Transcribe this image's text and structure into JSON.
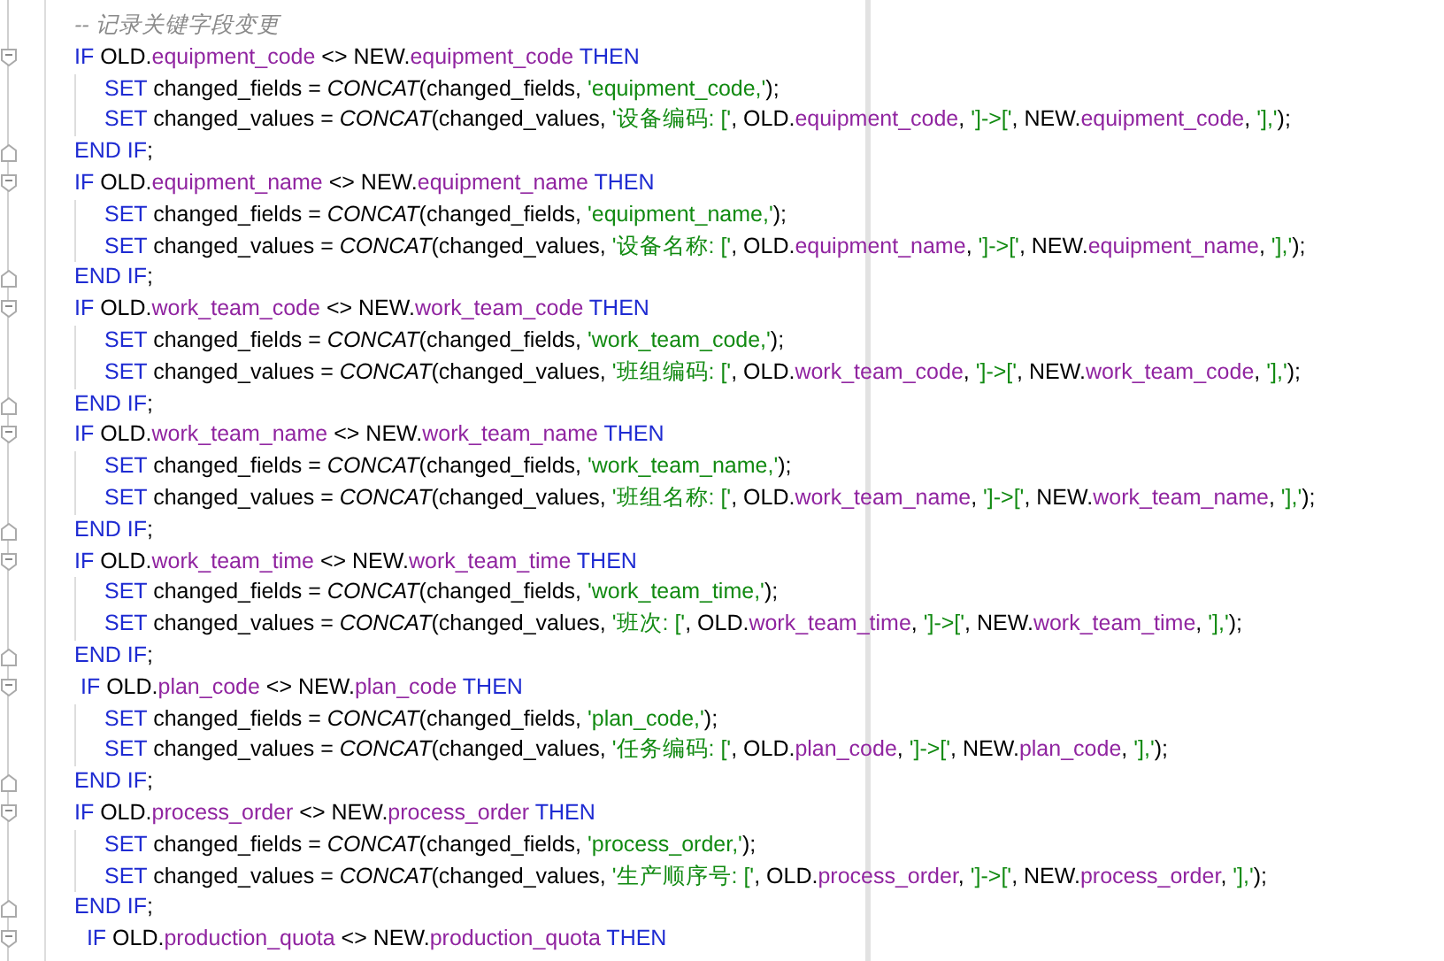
{
  "editor": {
    "lines": [
      {
        "kind": "comment",
        "tokens": [
          {
            "kind": "comment",
            "text": "-- 记录关键字段变更"
          }
        ]
      },
      {
        "kind": "block",
        "tokens": [
          {
            "kind": "kw",
            "text": "IF"
          },
          {
            "kind": "plain",
            "text": " OLD."
          },
          {
            "kind": "field",
            "text": "equipment_code"
          },
          {
            "kind": "plain",
            "text": " <> NEW."
          },
          {
            "kind": "field",
            "text": "equipment_code"
          },
          {
            "kind": "kw",
            "text": " THEN"
          }
        ],
        "children": [
          {
            "tokens": [
              {
                "kind": "kw",
                "text": "SET"
              },
              {
                "kind": "plain",
                "text": " changed_fields = "
              },
              {
                "kind": "fn",
                "text": "CONCAT"
              },
              {
                "kind": "plain",
                "text": "(changed_fields, "
              },
              {
                "kind": "str",
                "text": "'equipment_code,'"
              },
              {
                "kind": "plain",
                "text": ");"
              }
            ]
          },
          {
            "tokens": [
              {
                "kind": "kw",
                "text": "SET"
              },
              {
                "kind": "plain",
                "text": " changed_values = "
              },
              {
                "kind": "fn",
                "text": "CONCAT"
              },
              {
                "kind": "plain",
                "text": "(changed_values, "
              },
              {
                "kind": "str",
                "text": "'设备编码: ['"
              },
              {
                "kind": "plain",
                "text": ", OLD."
              },
              {
                "kind": "field",
                "text": "equipment_code"
              },
              {
                "kind": "plain",
                "text": ", "
              },
              {
                "kind": "str",
                "text": "']->['"
              },
              {
                "kind": "plain",
                "text": ", NEW."
              },
              {
                "kind": "field",
                "text": "equipment_code"
              },
              {
                "kind": "plain",
                "text": ", "
              },
              {
                "kind": "str",
                "text": "'],'"
              },
              {
                "kind": "plain",
                "text": ");"
              }
            ]
          }
        ]
      },
      {
        "kind": "end",
        "tokens": [
          {
            "kind": "kw",
            "text": "END IF"
          },
          {
            "kind": "plain",
            "text": ";"
          }
        ]
      },
      {
        "kind": "block",
        "tokens": [
          {
            "kind": "kw",
            "text": "IF"
          },
          {
            "kind": "plain",
            "text": " OLD."
          },
          {
            "kind": "field",
            "text": "equipment_name"
          },
          {
            "kind": "plain",
            "text": " <> NEW."
          },
          {
            "kind": "field",
            "text": "equipment_name"
          },
          {
            "kind": "kw",
            "text": " THEN"
          }
        ],
        "children": [
          {
            "tokens": [
              {
                "kind": "kw",
                "text": "SET"
              },
              {
                "kind": "plain",
                "text": " changed_fields = "
              },
              {
                "kind": "fn",
                "text": "CONCAT"
              },
              {
                "kind": "plain",
                "text": "(changed_fields, "
              },
              {
                "kind": "str",
                "text": "'equipment_name,'"
              },
              {
                "kind": "plain",
                "text": ");"
              }
            ]
          },
          {
            "tokens": [
              {
                "kind": "kw",
                "text": "SET"
              },
              {
                "kind": "plain",
                "text": " changed_values = "
              },
              {
                "kind": "fn",
                "text": "CONCAT"
              },
              {
                "kind": "plain",
                "text": "(changed_values, "
              },
              {
                "kind": "str",
                "text": "'设备名称: ['"
              },
              {
                "kind": "plain",
                "text": ", OLD."
              },
              {
                "kind": "field",
                "text": "equipment_name"
              },
              {
                "kind": "plain",
                "text": ", "
              },
              {
                "kind": "str",
                "text": "']->['"
              },
              {
                "kind": "plain",
                "text": ", NEW."
              },
              {
                "kind": "field",
                "text": "equipment_name"
              },
              {
                "kind": "plain",
                "text": ", "
              },
              {
                "kind": "str",
                "text": "'],'"
              },
              {
                "kind": "plain",
                "text": ");"
              }
            ]
          }
        ]
      },
      {
        "kind": "end",
        "tokens": [
          {
            "kind": "kw",
            "text": "END IF"
          },
          {
            "kind": "plain",
            "text": ";"
          }
        ]
      },
      {
        "kind": "block",
        "tokens": [
          {
            "kind": "kw",
            "text": "IF"
          },
          {
            "kind": "plain",
            "text": " OLD."
          },
          {
            "kind": "field",
            "text": "work_team_code"
          },
          {
            "kind": "plain",
            "text": " <> NEW."
          },
          {
            "kind": "field",
            "text": "work_team_code"
          },
          {
            "kind": "kw",
            "text": " THEN"
          }
        ],
        "children": [
          {
            "tokens": [
              {
                "kind": "kw",
                "text": "SET"
              },
              {
                "kind": "plain",
                "text": " changed_fields = "
              },
              {
                "kind": "fn",
                "text": "CONCAT"
              },
              {
                "kind": "plain",
                "text": "(changed_fields, "
              },
              {
                "kind": "str",
                "text": "'work_team_code,'"
              },
              {
                "kind": "plain",
                "text": ");"
              }
            ]
          },
          {
            "tokens": [
              {
                "kind": "kw",
                "text": "SET"
              },
              {
                "kind": "plain",
                "text": " changed_values = "
              },
              {
                "kind": "fn",
                "text": "CONCAT"
              },
              {
                "kind": "plain",
                "text": "(changed_values, "
              },
              {
                "kind": "str",
                "text": "'班组编码: ['"
              },
              {
                "kind": "plain",
                "text": ", OLD."
              },
              {
                "kind": "field",
                "text": "work_team_code"
              },
              {
                "kind": "plain",
                "text": ", "
              },
              {
                "kind": "str",
                "text": "']->['"
              },
              {
                "kind": "plain",
                "text": ", NEW."
              },
              {
                "kind": "field",
                "text": "work_team_code"
              },
              {
                "kind": "plain",
                "text": ", "
              },
              {
                "kind": "str",
                "text": "'],'"
              },
              {
                "kind": "plain",
                "text": ");"
              }
            ]
          }
        ]
      },
      {
        "kind": "end",
        "tokens": [
          {
            "kind": "kw",
            "text": "END IF"
          },
          {
            "kind": "plain",
            "text": ";"
          }
        ]
      },
      {
        "kind": "block",
        "tokens": [
          {
            "kind": "kw",
            "text": "IF"
          },
          {
            "kind": "plain",
            "text": " OLD."
          },
          {
            "kind": "field",
            "text": "work_team_name"
          },
          {
            "kind": "plain",
            "text": " <> NEW."
          },
          {
            "kind": "field",
            "text": "work_team_name"
          },
          {
            "kind": "kw",
            "text": " THEN"
          }
        ],
        "children": [
          {
            "tokens": [
              {
                "kind": "kw",
                "text": "SET"
              },
              {
                "kind": "plain",
                "text": " changed_fields = "
              },
              {
                "kind": "fn",
                "text": "CONCAT"
              },
              {
                "kind": "plain",
                "text": "(changed_fields, "
              },
              {
                "kind": "str",
                "text": "'work_team_name,'"
              },
              {
                "kind": "plain",
                "text": ");"
              }
            ]
          },
          {
            "tokens": [
              {
                "kind": "kw",
                "text": "SET"
              },
              {
                "kind": "plain",
                "text": " changed_values = "
              },
              {
                "kind": "fn",
                "text": "CONCAT"
              },
              {
                "kind": "plain",
                "text": "(changed_values, "
              },
              {
                "kind": "str",
                "text": "'班组名称: ['"
              },
              {
                "kind": "plain",
                "text": ", OLD."
              },
              {
                "kind": "field",
                "text": "work_team_name"
              },
              {
                "kind": "plain",
                "text": ", "
              },
              {
                "kind": "str",
                "text": "']->['"
              },
              {
                "kind": "plain",
                "text": ", NEW."
              },
              {
                "kind": "field",
                "text": "work_team_name"
              },
              {
                "kind": "plain",
                "text": ", "
              },
              {
                "kind": "str",
                "text": "'],'"
              },
              {
                "kind": "plain",
                "text": ");"
              }
            ]
          }
        ]
      },
      {
        "kind": "end",
        "tokens": [
          {
            "kind": "kw",
            "text": "END IF"
          },
          {
            "kind": "plain",
            "text": ";"
          }
        ]
      },
      {
        "kind": "block",
        "tokens": [
          {
            "kind": "kw",
            "text": "IF"
          },
          {
            "kind": "plain",
            "text": " OLD."
          },
          {
            "kind": "field",
            "text": "work_team_time"
          },
          {
            "kind": "plain",
            "text": " <> NEW."
          },
          {
            "kind": "field",
            "text": "work_team_time"
          },
          {
            "kind": "kw",
            "text": " THEN"
          }
        ],
        "children": [
          {
            "tokens": [
              {
                "kind": "kw",
                "text": "SET"
              },
              {
                "kind": "plain",
                "text": " changed_fields = "
              },
              {
                "kind": "fn",
                "text": "CONCAT"
              },
              {
                "kind": "plain",
                "text": "(changed_fields, "
              },
              {
                "kind": "str",
                "text": "'work_team_time,'"
              },
              {
                "kind": "plain",
                "text": ");"
              }
            ]
          },
          {
            "tokens": [
              {
                "kind": "kw",
                "text": "SET"
              },
              {
                "kind": "plain",
                "text": " changed_values = "
              },
              {
                "kind": "fn",
                "text": "CONCAT"
              },
              {
                "kind": "plain",
                "text": "(changed_values, "
              },
              {
                "kind": "str",
                "text": "'班次: ['"
              },
              {
                "kind": "plain",
                "text": ", OLD."
              },
              {
                "kind": "field",
                "text": "work_team_time"
              },
              {
                "kind": "plain",
                "text": ", "
              },
              {
                "kind": "str",
                "text": "']->['"
              },
              {
                "kind": "plain",
                "text": ", NEW."
              },
              {
                "kind": "field",
                "text": "work_team_time"
              },
              {
                "kind": "plain",
                "text": ", "
              },
              {
                "kind": "str",
                "text": "'],'"
              },
              {
                "kind": "plain",
                "text": ");"
              }
            ]
          }
        ]
      },
      {
        "kind": "end",
        "tokens": [
          {
            "kind": "kw",
            "text": "END IF"
          },
          {
            "kind": "plain",
            "text": ";"
          }
        ]
      },
      {
        "kind": "block",
        "tokens": [
          {
            "kind": "kw",
            "text": " IF"
          },
          {
            "kind": "plain",
            "text": " OLD."
          },
          {
            "kind": "field",
            "text": "plan_code"
          },
          {
            "kind": "plain",
            "text": " <> NEW."
          },
          {
            "kind": "field",
            "text": "plan_code"
          },
          {
            "kind": "kw",
            "text": " THEN"
          }
        ],
        "children": [
          {
            "tokens": [
              {
                "kind": "kw",
                "text": "SET"
              },
              {
                "kind": "plain",
                "text": " changed_fields = "
              },
              {
                "kind": "fn",
                "text": "CONCAT"
              },
              {
                "kind": "plain",
                "text": "(changed_fields, "
              },
              {
                "kind": "str",
                "text": "'plan_code,'"
              },
              {
                "kind": "plain",
                "text": ");"
              }
            ]
          },
          {
            "tokens": [
              {
                "kind": "kw",
                "text": "SET"
              },
              {
                "kind": "plain",
                "text": " changed_values = "
              },
              {
                "kind": "fn",
                "text": "CONCAT"
              },
              {
                "kind": "plain",
                "text": "(changed_values, "
              },
              {
                "kind": "str",
                "text": "'任务编码: ['"
              },
              {
                "kind": "plain",
                "text": ", OLD."
              },
              {
                "kind": "field",
                "text": "plan_code"
              },
              {
                "kind": "plain",
                "text": ", "
              },
              {
                "kind": "str",
                "text": "']->['"
              },
              {
                "kind": "plain",
                "text": ", NEW."
              },
              {
                "kind": "field",
                "text": "plan_code"
              },
              {
                "kind": "plain",
                "text": ", "
              },
              {
                "kind": "str",
                "text": "'],'"
              },
              {
                "kind": "plain",
                "text": ");"
              }
            ]
          }
        ]
      },
      {
        "kind": "end",
        "tokens": [
          {
            "kind": "kw",
            "text": "END IF"
          },
          {
            "kind": "plain",
            "text": ";"
          }
        ]
      },
      {
        "kind": "block",
        "tokens": [
          {
            "kind": "kw",
            "text": "IF"
          },
          {
            "kind": "plain",
            "text": " OLD."
          },
          {
            "kind": "field",
            "text": "process_order"
          },
          {
            "kind": "plain",
            "text": " <> NEW."
          },
          {
            "kind": "field",
            "text": "process_order"
          },
          {
            "kind": "kw",
            "text": " THEN"
          }
        ],
        "children": [
          {
            "tokens": [
              {
                "kind": "kw",
                "text": "SET"
              },
              {
                "kind": "plain",
                "text": " changed_fields = "
              },
              {
                "kind": "fn",
                "text": "CONCAT"
              },
              {
                "kind": "plain",
                "text": "(changed_fields, "
              },
              {
                "kind": "str",
                "text": "'process_order,'"
              },
              {
                "kind": "plain",
                "text": ");"
              }
            ]
          },
          {
            "tokens": [
              {
                "kind": "kw",
                "text": "SET"
              },
              {
                "kind": "plain",
                "text": " changed_values = "
              },
              {
                "kind": "fn",
                "text": "CONCAT"
              },
              {
                "kind": "plain",
                "text": "(changed_values, "
              },
              {
                "kind": "str",
                "text": "'生产顺序号: ['"
              },
              {
                "kind": "plain",
                "text": ", OLD."
              },
              {
                "kind": "field",
                "text": "process_order"
              },
              {
                "kind": "plain",
                "text": ", "
              },
              {
                "kind": "str",
                "text": "']->['"
              },
              {
                "kind": "plain",
                "text": ", NEW."
              },
              {
                "kind": "field",
                "text": "process_order"
              },
              {
                "kind": "plain",
                "text": ", "
              },
              {
                "kind": "str",
                "text": "'],'"
              },
              {
                "kind": "plain",
                "text": ");"
              }
            ]
          }
        ]
      },
      {
        "kind": "end",
        "tokens": [
          {
            "kind": "kw",
            "text": "END IF"
          },
          {
            "kind": "plain",
            "text": ";"
          }
        ]
      },
      {
        "kind": "block",
        "tokens": [
          {
            "kind": "kw",
            "text": "  IF"
          },
          {
            "kind": "plain",
            "text": " OLD."
          },
          {
            "kind": "field",
            "text": "production_quota"
          },
          {
            "kind": "plain",
            "text": " <> NEW."
          },
          {
            "kind": "field",
            "text": "production_quota"
          },
          {
            "kind": "kw",
            "text": " THEN"
          }
        ]
      }
    ]
  }
}
